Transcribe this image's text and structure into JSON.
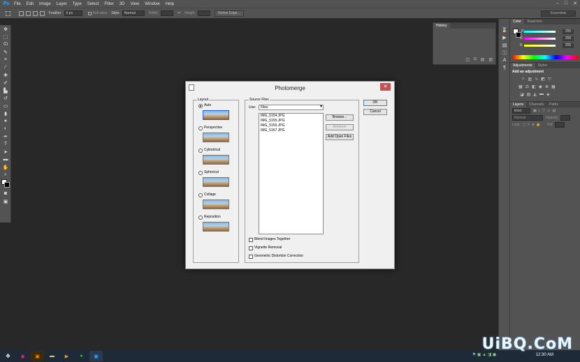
{
  "app": {
    "logo": "Ps"
  },
  "menu": [
    "File",
    "Edit",
    "Image",
    "Layer",
    "Type",
    "Select",
    "Filter",
    "3D",
    "View",
    "Window",
    "Help"
  ],
  "options_bar": {
    "feather_label": "Feather:",
    "feather_value": "0 px",
    "anti_alias_label": "Anti-alias",
    "style_label": "Style:",
    "style_value": "Normal",
    "width_label": "Width:",
    "height_label": "Height:",
    "refine_edge_label": "Refine Edge...",
    "workspace": "Essentials"
  },
  "history_panel": {
    "tab": "History"
  },
  "color_panel": {
    "tabs": [
      "Color",
      "Swatches"
    ],
    "channels": [
      {
        "name": "R",
        "value": "255"
      },
      {
        "name": "G",
        "value": "255"
      },
      {
        "name": "B",
        "value": "255"
      }
    ]
  },
  "adjustments_panel": {
    "tabs": [
      "Adjustments",
      "Styles"
    ],
    "heading": "Add an adjustment"
  },
  "layers_panel": {
    "tabs": [
      "Layers",
      "Channels",
      "Paths"
    ],
    "kind_label": "Kind",
    "blend_mode": "Normal",
    "opacity_label": "Opacity:",
    "lock_label": "Lock:",
    "fill_label": "Fill:"
  },
  "dialog": {
    "title": "Photomerge",
    "layout_group": "Layout",
    "layouts": [
      {
        "label": "Auto",
        "checked": true
      },
      {
        "label": "Perspective",
        "checked": false
      },
      {
        "label": "Cylindrical",
        "checked": false
      },
      {
        "label": "Spherical",
        "checked": false
      },
      {
        "label": "Collage",
        "checked": false
      },
      {
        "label": "Reposition",
        "checked": false
      }
    ],
    "source_group": "Source Files",
    "use_label": "Use:",
    "use_value": "Files",
    "files": [
      "IMG_5154.JPG",
      "IMG_5155.JPG",
      "IMG_5156.JPG",
      "IMG_5157.JPG"
    ],
    "browse_label": "Browse...",
    "remove_label": "Remove",
    "add_open_label": "Add Open Files",
    "ok_label": "OK",
    "cancel_label": "Cancel",
    "options": [
      {
        "label": "Blend Images Together",
        "checked": false
      },
      {
        "label": "Vignette Removal",
        "checked": false
      },
      {
        "label": "Geometric Distortion Correction",
        "checked": false
      }
    ]
  },
  "taskbar": {
    "clock": "12:30 AM"
  },
  "watermark": "UiBQ.CoM"
}
